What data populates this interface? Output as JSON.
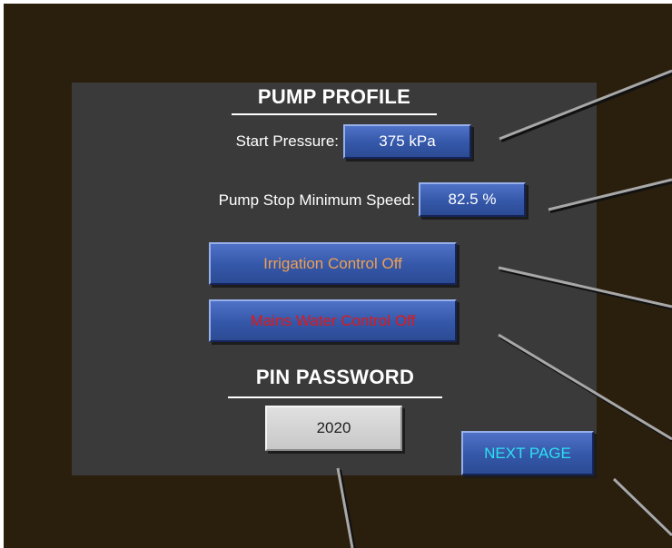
{
  "panel": {
    "pump_profile": {
      "heading": "PUMP PROFILE",
      "start_pressure_label": "Start Pressure:",
      "start_pressure_value": "375 kPa",
      "stop_speed_label": "Pump Stop Minimum Speed:",
      "stop_speed_value": "82.5 %"
    },
    "controls": {
      "irrigation_label": "Irrigation Control Off",
      "mains_label": "Mains Water Control Off"
    },
    "pin": {
      "heading": "PIN PASSWORD",
      "value": "2020"
    },
    "next_page_label": "NEXT PAGE"
  },
  "colors": {
    "frame_background": "#2a1e0c",
    "panel_background": "#3a3a3a",
    "button_blue": "#3457a8",
    "irrigation_text": "#f0a050",
    "mains_text": "#e01818",
    "next_page_text": "#2ee0f0",
    "pin_text": "#222222"
  }
}
